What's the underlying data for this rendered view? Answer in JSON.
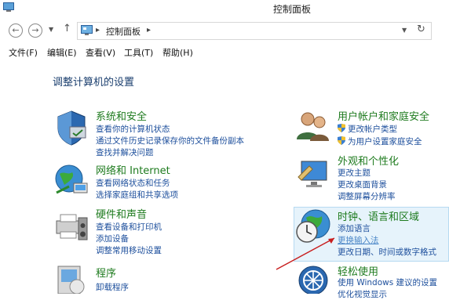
{
  "window": {
    "title": "控制面板"
  },
  "address": {
    "crumb": "控制面板"
  },
  "menu": [
    "文件(F)",
    "编辑(E)",
    "查看(V)",
    "工具(T)",
    "帮助(H)"
  ],
  "page": {
    "heading": "调整计算机的设置"
  },
  "categories": {
    "system": {
      "title": "系统和安全",
      "links": [
        "查看你的计算机状态",
        "通过文件历史记录保存你的文件备份副本",
        "查找并解决问题"
      ]
    },
    "network": {
      "title": "网络和 Internet",
      "links": [
        "查看网络状态和任务",
        "选择家庭组和共享选项"
      ]
    },
    "hardware": {
      "title": "硬件和声音",
      "links": [
        "查看设备和打印机",
        "添加设备",
        "调整常用移动设置"
      ]
    },
    "programs": {
      "title": "程序",
      "links": [
        "卸载程序"
      ]
    },
    "users": {
      "title": "用户帐户和家庭安全",
      "links": [
        "更改帐户类型",
        "为用户设置家庭安全"
      ]
    },
    "appearance": {
      "title": "外观和个性化",
      "links": [
        "更改主题",
        "更改桌面背景",
        "调整屏幕分辨率"
      ]
    },
    "clock": {
      "title": "时钟、语言和区域",
      "links": [
        "添加语言",
        "更换输入法",
        "更改日期、时间或数字格式"
      ]
    },
    "ease": {
      "title": "轻松使用",
      "links": [
        "使用 Windows 建议的设置",
        "优化视觉显示"
      ]
    }
  },
  "colors": {
    "category_title": "#1e7b1e",
    "link": "#1d4f9c",
    "heading": "#1a3e6e",
    "highlight": "#e6f3fb"
  }
}
